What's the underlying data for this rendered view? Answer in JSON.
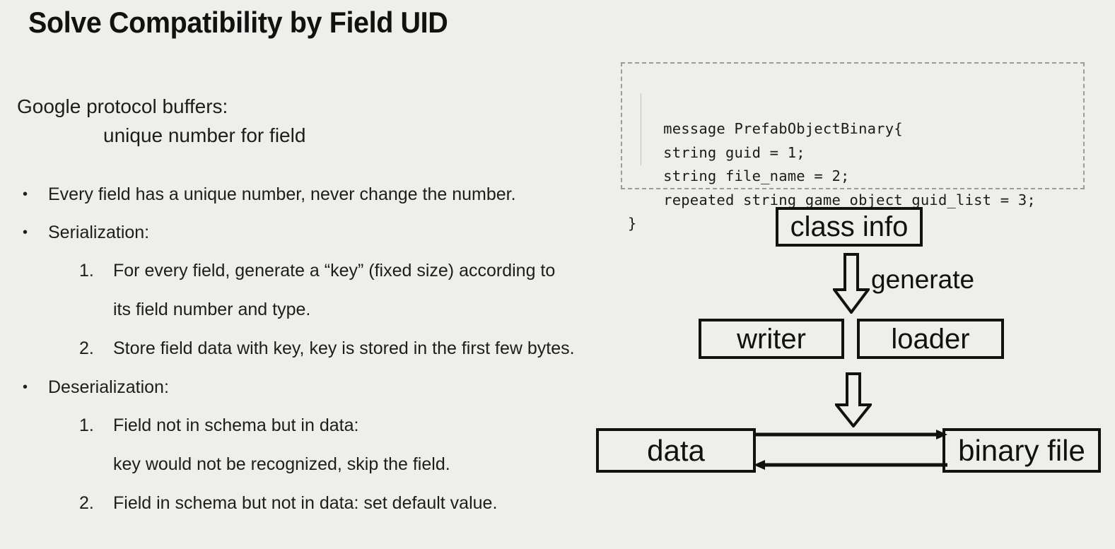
{
  "slide": {
    "title": "Solve Compatibility by Field UID",
    "background_color": "#eeeeea",
    "text_color": "#1d1d1d"
  },
  "lead": {
    "line1": "Google protocol buffers:",
    "line2": "unique number for field"
  },
  "bullets": [
    {
      "marker": "•",
      "text": "Every field has a unique number, never change the number."
    },
    {
      "marker": "•",
      "text": "Serialization:"
    },
    {
      "marker": "1.",
      "text": "For every field, generate a “key” (fixed size) according to",
      "continuation": "its field number and type."
    },
    {
      "marker": "2.",
      "text": "Store field data with key, key is stored in the first few bytes."
    },
    {
      "marker": "•",
      "text": "Deserialization:"
    },
    {
      "marker": "1.",
      "text": "Field not in schema but in data:",
      "continuation": "key would not be recognized, skip the field."
    },
    {
      "marker": "2.",
      "text": "Field in schema but not in data: set default value."
    }
  ],
  "code_block": {
    "border_style": "dashed",
    "border_color": "#9b9b9b",
    "lines": [
      "message PrefabObjectBinary{",
      "    string guid = 1;",
      "    string file_name = 2;",
      "    repeated string game_object_guid_list = 3;",
      "}"
    ],
    "text": "message PrefabObjectBinary{\n    string guid = 1;\n    string file_name = 2;\n    repeated string game_object_guid_list = 3;\n}"
  },
  "diagram": {
    "boxes": {
      "class_info": "class info",
      "writer": "writer",
      "loader": "loader",
      "data": "data",
      "binary_file": "binary file"
    },
    "labels": {
      "generate": "generate"
    },
    "arrows": [
      {
        "name": "generate-arrow",
        "from": "class info",
        "to": "writer / loader",
        "direction": "down",
        "style": "block"
      },
      {
        "name": "write-arrow",
        "from": "writer / loader",
        "to": "data",
        "direction": "down",
        "style": "block"
      },
      {
        "name": "data-to-binary",
        "from": "data",
        "to": "binary file",
        "direction": "right",
        "style": "line"
      },
      {
        "name": "binary-to-data",
        "from": "binary file",
        "to": "data",
        "direction": "left",
        "style": "line"
      }
    ],
    "line_color": "#111111"
  }
}
